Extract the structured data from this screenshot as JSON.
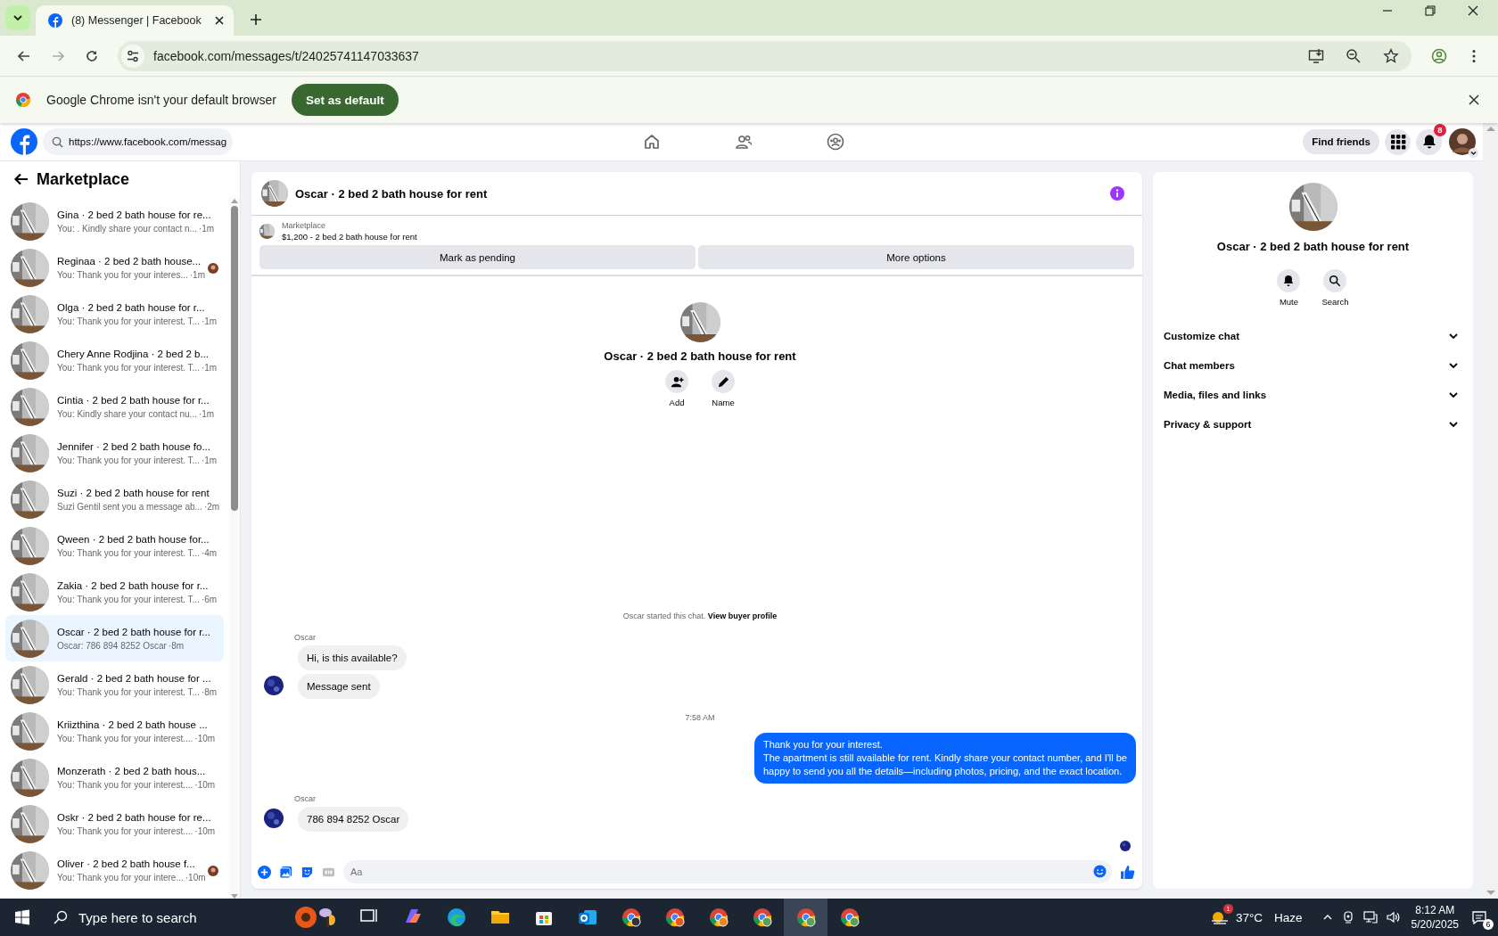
{
  "browser": {
    "tabs": [
      {
        "title": "(8) Messenger | Facebook",
        "selected": true
      }
    ],
    "url": "facebook.com/messages/t/24025741147033637",
    "infobar": {
      "message": "Google Chrome isn't your default browser",
      "button": "Set as default"
    }
  },
  "topnav": {
    "search_value": "https://www.facebook.com/messag",
    "find_friends": "Find friends",
    "notification_count": "8"
  },
  "sidebar": {
    "title": "Marketplace",
    "conversations": [
      {
        "title": "Gina · 2 bed 2 bath house for re...",
        "preview": "You: . Kindly share your contact n...",
        "time": "·1m",
        "selected": false,
        "seen": false
      },
      {
        "title": "Reginaa · 2 bed 2 bath house...",
        "preview": "You: Thank you for your interes...",
        "time": "·1m",
        "selected": false,
        "seen": true
      },
      {
        "title": "Olga · 2 bed 2 bath house for r...",
        "preview": "You: Thank you for your interest. T...",
        "time": "·1m",
        "selected": false,
        "seen": false
      },
      {
        "title": "Chery Anne Rodjina · 2 bed 2 b...",
        "preview": "You: Thank you for your interest. T...",
        "time": "·1m",
        "selected": false,
        "seen": false
      },
      {
        "title": "Cintia · 2 bed 2 bath house for r...",
        "preview": "You: Kindly share your contact nu...",
        "time": "·1m",
        "selected": false,
        "seen": false
      },
      {
        "title": "Jennifer · 2 bed 2 bath house fo...",
        "preview": "You: Thank you for your interest. T...",
        "time": "·1m",
        "selected": false,
        "seen": false
      },
      {
        "title": "Suzi · 2 bed 2 bath house for rent",
        "preview": "Suzi Gentil sent you a message ab...",
        "time": "·2m",
        "selected": false,
        "seen": false
      },
      {
        "title": "Qween · 2 bed 2 bath house for...",
        "preview": "You: Thank you for your interest. T...",
        "time": "·4m",
        "selected": false,
        "seen": false
      },
      {
        "title": "Zakia · 2 bed 2 bath house for r...",
        "preview": "You: Thank you for your interest. T...",
        "time": "·6m",
        "selected": false,
        "seen": false
      },
      {
        "title": "Oscar · 2 bed 2 bath house for r...",
        "preview": "Oscar: 786 894 8252 Oscar",
        "time": "·8m",
        "selected": true,
        "seen": false
      },
      {
        "title": "Gerald · 2 bed 2 bath house for ...",
        "preview": "You: Thank you for your interest. T...",
        "time": "·8m",
        "selected": false,
        "seen": false
      },
      {
        "title": "Kriizthina · 2 bed 2 bath house ...",
        "preview": "You: Thank you for your interest....",
        "time": "·10m",
        "selected": false,
        "seen": false
      },
      {
        "title": "Monzerath · 2 bed 2 bath hous...",
        "preview": "You: Thank you for your interest....",
        "time": "·10m",
        "selected": false,
        "seen": false
      },
      {
        "title": "Oskr · 2 bed 2 bath house for re...",
        "preview": "You: Thank you for your interest....",
        "time": "·10m",
        "selected": false,
        "seen": false
      },
      {
        "title": "Oliver · 2 bed 2 bath house f...",
        "preview": "You: Thank you for your intere...",
        "time": "·10m",
        "selected": false,
        "seen": true
      }
    ]
  },
  "chat": {
    "title": "Oscar · 2 bed 2 bath house for rent",
    "listing_label": "Marketplace",
    "listing": "$1,200 - 2 bed 2 bath house for rent",
    "actions": [
      "Mark as pending",
      "More options"
    ],
    "intro": {
      "name": "Oscar · 2 bed 2 bath house for rent",
      "buttons": [
        "Add",
        "Name"
      ]
    },
    "messages": [
      {
        "kind": "system",
        "text": "Oscar started this chat.",
        "link": "View buyer profile"
      },
      {
        "kind": "incoming",
        "sender": "Oscar",
        "bubbles": [
          "Hi, is this available?",
          "Message sent"
        ]
      },
      {
        "kind": "timestamp",
        "text": "7:58 AM"
      },
      {
        "kind": "outgoing",
        "lines": [
          "Thank you for your interest.",
          "The apartment is still available for rent. Kindly share your contact number, and I'll be",
          "happy to send you all the details—including photos, pricing, and the exact location."
        ]
      },
      {
        "kind": "incoming",
        "sender": "Oscar",
        "bubbles": [
          "786 894 8252 Oscar"
        ]
      }
    ],
    "composer_placeholder": "Aa"
  },
  "details": {
    "title": "Oscar · 2 bed 2 bath house for rent",
    "actions": [
      "Mute",
      "Search"
    ],
    "sections": [
      "Customize chat",
      "Chat members",
      "Media, files and links",
      "Privacy & support"
    ]
  },
  "taskbar": {
    "search_placeholder": "Type here to search",
    "weather_badge": "1",
    "temperature": "37°C",
    "weather": "Haze",
    "time": "8:12 AM",
    "date": "5/20/2025",
    "notifications": "6"
  }
}
